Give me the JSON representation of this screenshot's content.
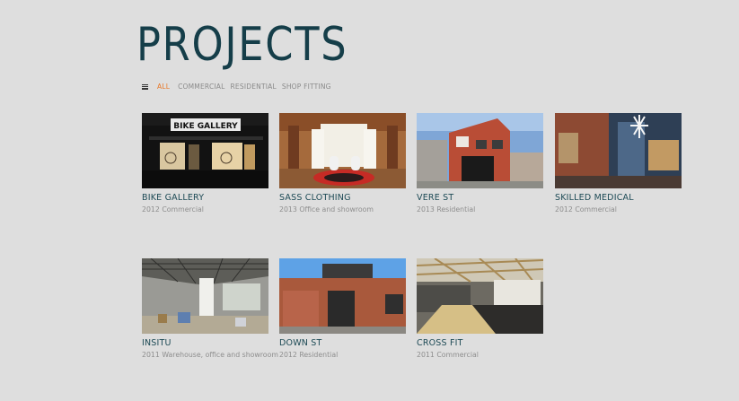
{
  "page": {
    "title": "PROJECTS"
  },
  "filters": {
    "all": "ALL",
    "commercial": "COMMERCIAL",
    "residential": "RESIDENTIAL",
    "shop_fitting": "SHOP FITTING"
  },
  "projects": [
    {
      "name": "BIKE GALLERY",
      "meta": "2012 Commercial",
      "sign": "BIKE GALLERY"
    },
    {
      "name": "SASS CLOTHING",
      "meta": "2013 Office and showroom"
    },
    {
      "name": "VERE ST",
      "meta": "2013 Residential"
    },
    {
      "name": "SKILLED MEDICAL",
      "meta": "2012 Commercial"
    },
    {
      "name": "INSITU",
      "meta": "2011 Warehouse, office and showroom"
    },
    {
      "name": "DOWN ST",
      "meta": "2012 Residential"
    },
    {
      "name": "CROSS FIT",
      "meta": "2011 Commercial"
    }
  ],
  "colors": {
    "title": "#153e49",
    "active_filter": "#e8792a",
    "background": "#dedede"
  }
}
